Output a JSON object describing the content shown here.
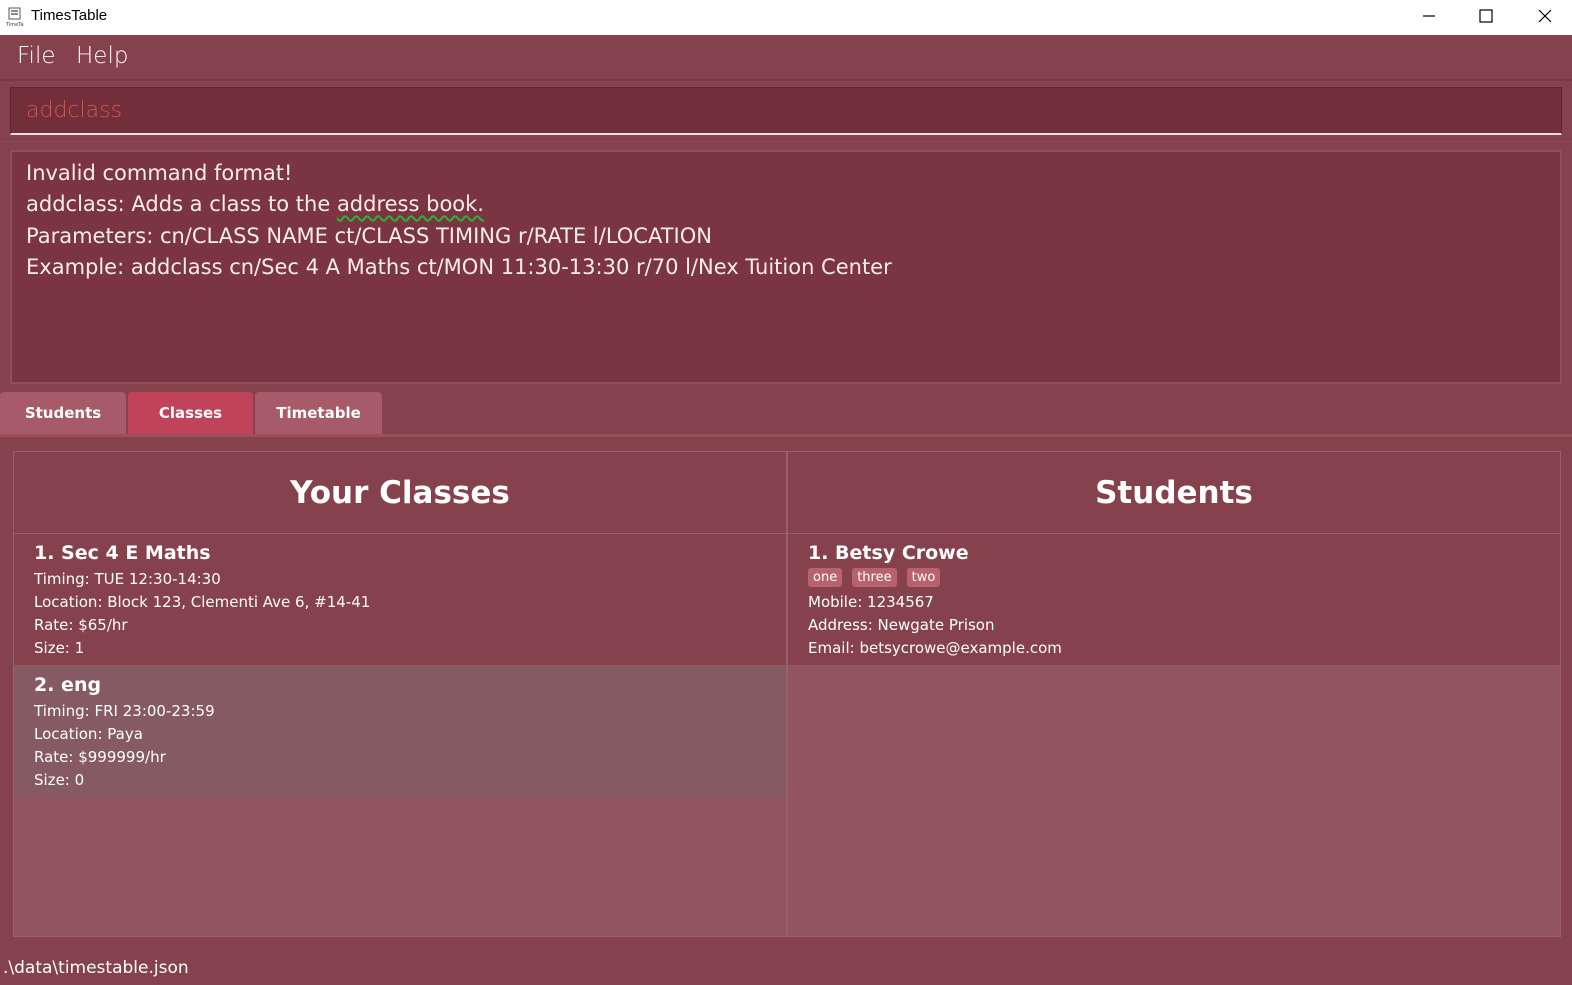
{
  "window": {
    "title": "TimesTable",
    "controls": {
      "minimize_icon": "minimize-icon",
      "maximize_icon": "maximize-icon",
      "close_icon": "close-icon"
    }
  },
  "menu": {
    "file": "File",
    "help": "Help"
  },
  "command": {
    "value": "addclass"
  },
  "result": {
    "line1": "Invalid command format!",
    "line2_prefix": "addclass: Adds a class to the ",
    "line2_underlined": "address book.",
    "line3": "Parameters: cn/CLASS NAME ct/CLASS TIMING r/RATE l/LOCATION",
    "line4": "Example: addclass cn/Sec 4 A Maths ct/MON 11:30-13:30 r/70 l/Nex Tuition Center"
  },
  "tabs": [
    {
      "label": "Students"
    },
    {
      "label": "Classes",
      "selected": true
    },
    {
      "label": "Timetable"
    }
  ],
  "classes": {
    "header": "Your Classes",
    "items": [
      {
        "title": "1.  Sec 4 E Maths",
        "timing": "Timing: TUE 12:30-14:30",
        "location": "Location: Block 123, Clementi Ave 6, #14-41",
        "rate": "Rate: $65/hr",
        "size": "Size: 1"
      },
      {
        "title": "2.  eng",
        "timing": "Timing: FRI 23:00-23:59",
        "location": "Location: Paya",
        "rate": "Rate: $999999/hr",
        "size": "Size: 0"
      }
    ]
  },
  "students": {
    "header": "Students",
    "items": [
      {
        "title": "1.  Betsy Crowe",
        "tags": [
          "one",
          "three",
          "two"
        ],
        "mobile": "Mobile: 1234567",
        "address": "Address: Newgate Prison",
        "email": "Email: betsycrowe@example.com"
      }
    ]
  },
  "status": {
    "path": ".\\data\\timestable.json"
  },
  "colors": {
    "accent": "#c0435a",
    "background": "#86424c",
    "command_text": "#d9534f"
  }
}
